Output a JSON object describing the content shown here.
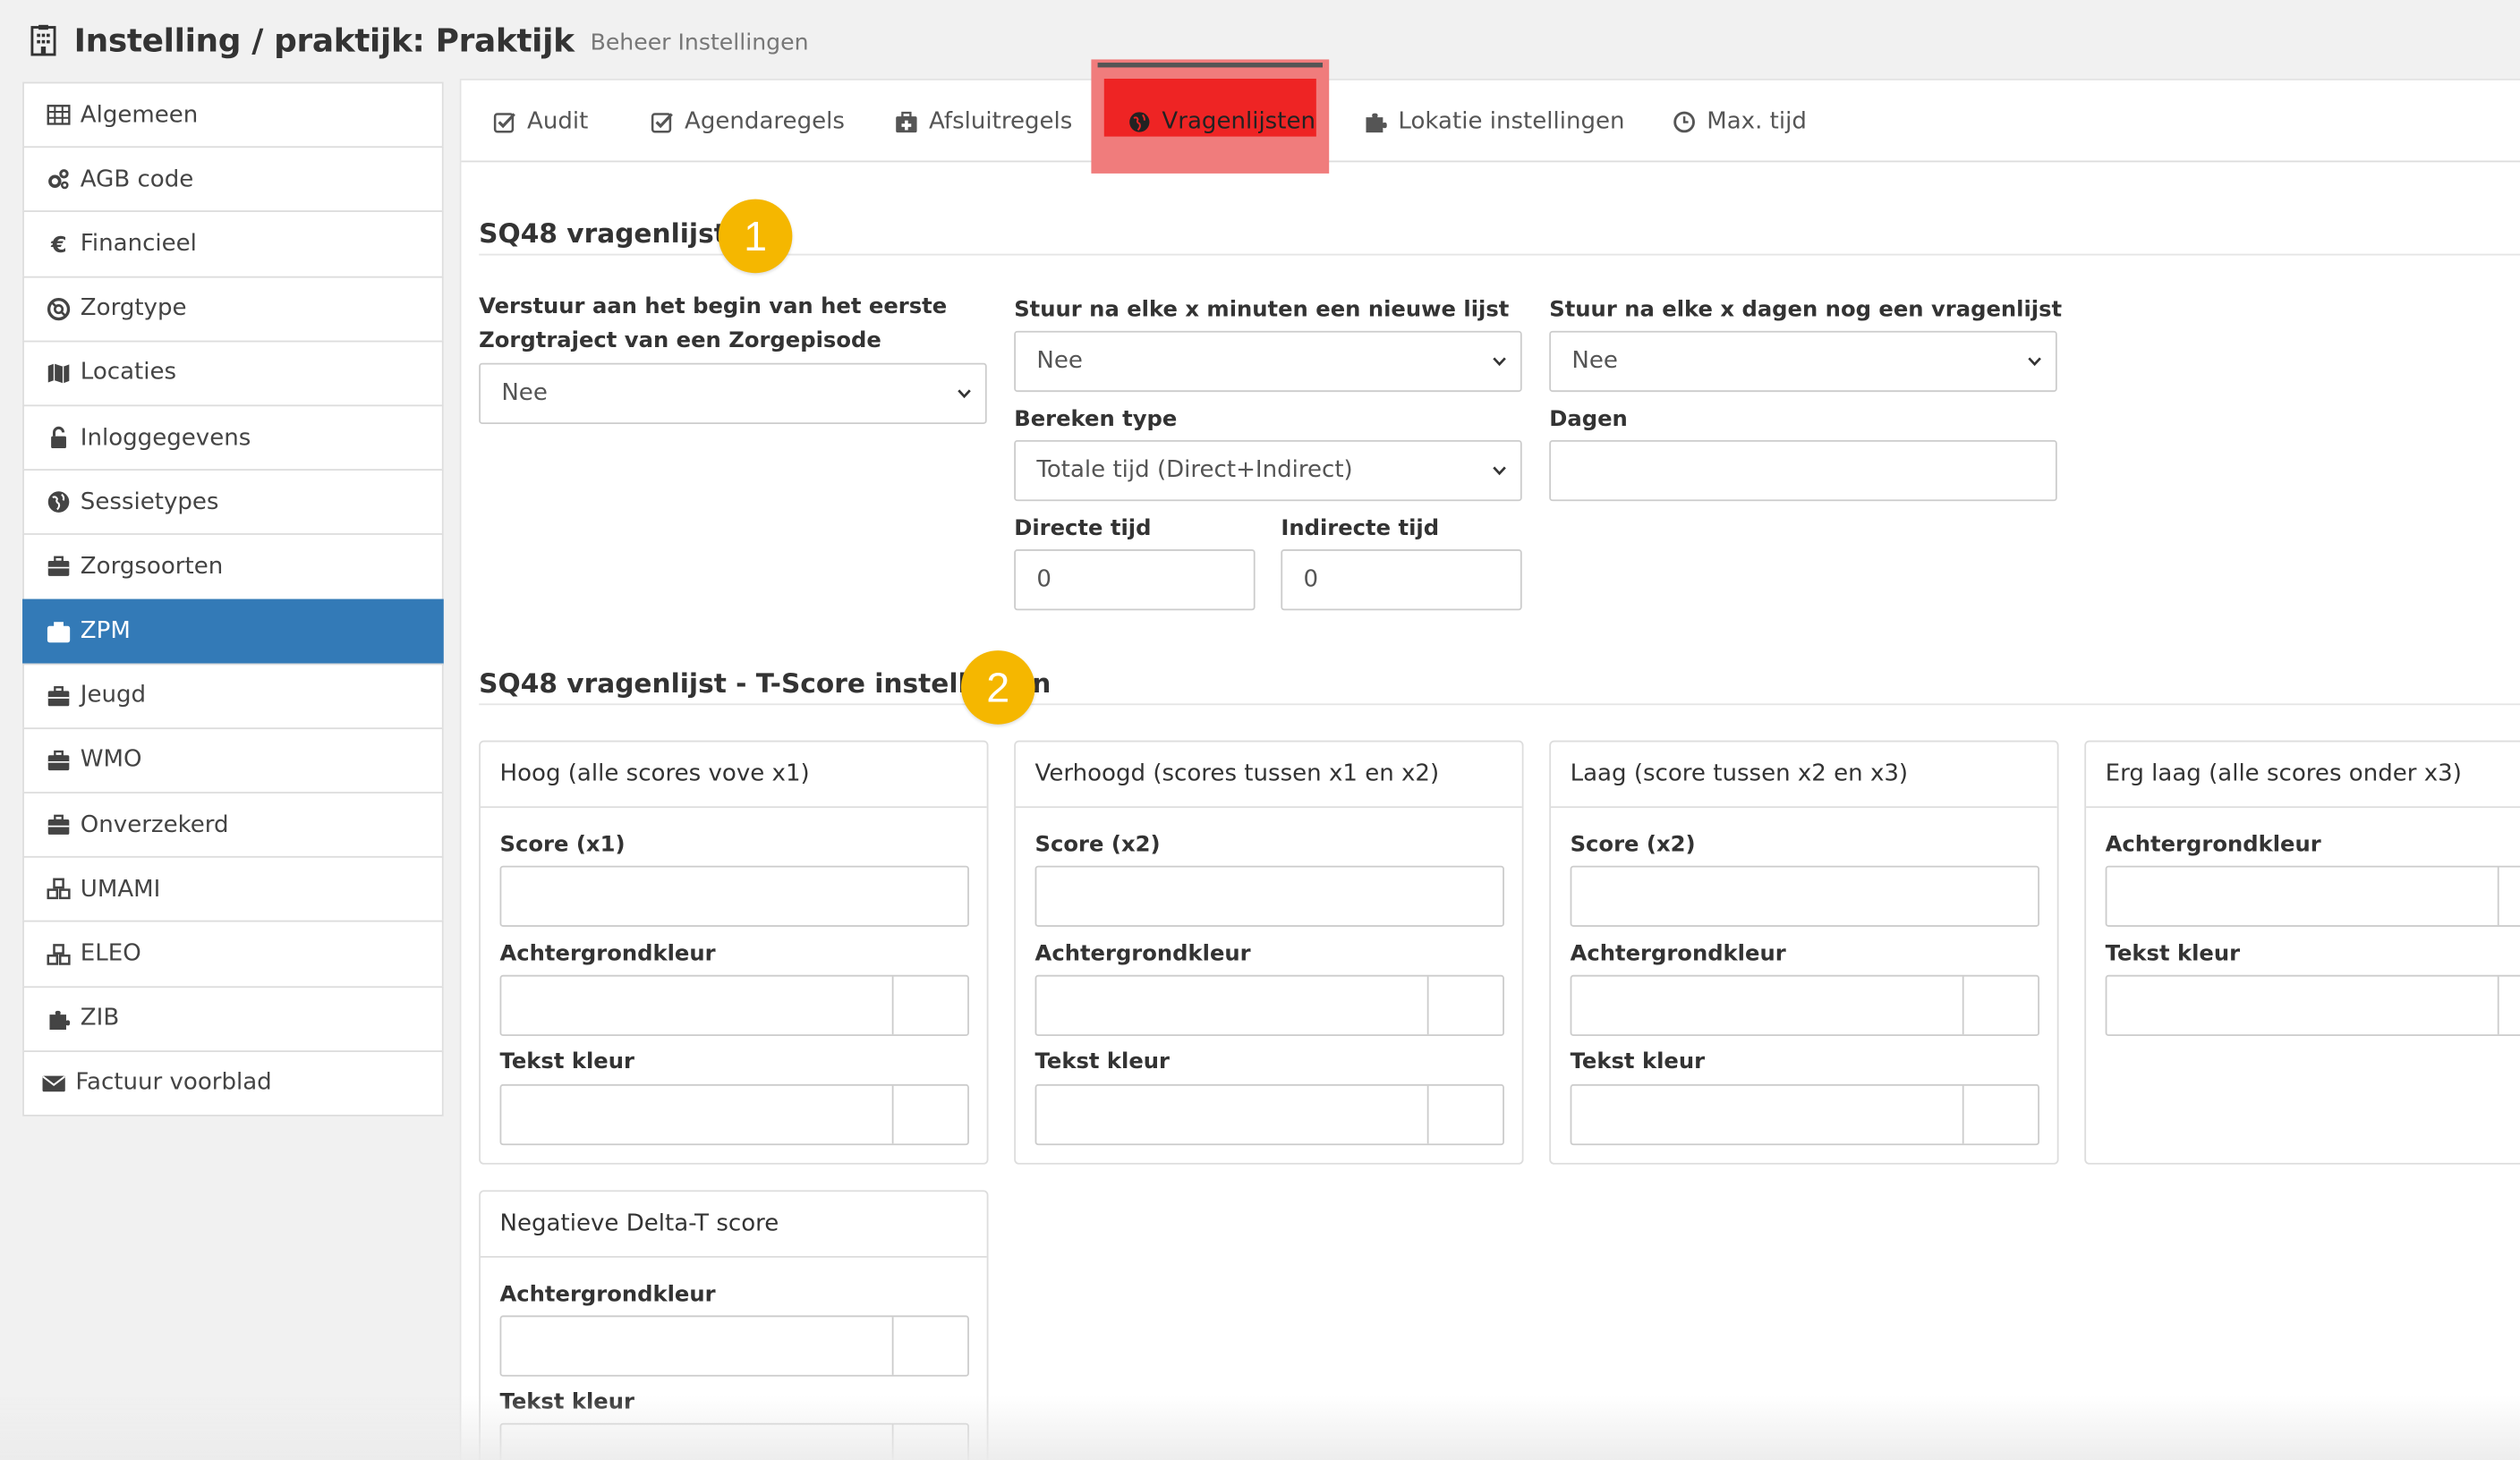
{
  "header": {
    "title": "Instelling / praktijk: Praktijk",
    "subtitle": "Beheer Instellingen"
  },
  "sidebar": {
    "items": [
      {
        "label": "Algemeen",
        "icon": "table-icon"
      },
      {
        "label": "AGB code",
        "icon": "cogs-icon"
      },
      {
        "label": "Financieel",
        "icon": "euro-icon"
      },
      {
        "label": "Zorgtype",
        "icon": "life-ring-icon"
      },
      {
        "label": "Locaties",
        "icon": "map-icon"
      },
      {
        "label": "Inloggegevens",
        "icon": "unlock-icon"
      },
      {
        "label": "Sessietypes",
        "icon": "globe-icon"
      },
      {
        "label": "Zorgsoorten",
        "icon": "briefcase-icon"
      },
      {
        "label": "ZPM",
        "icon": "briefcase-icon"
      },
      {
        "label": "Jeugd",
        "icon": "briefcase-icon"
      },
      {
        "label": "WMO",
        "icon": "briefcase-icon"
      },
      {
        "label": "Onverzekerd",
        "icon": "briefcase-icon"
      },
      {
        "label": "UMAMI",
        "icon": "cubes-icon"
      },
      {
        "label": "ELEO",
        "icon": "cubes-icon"
      },
      {
        "label": "ZIB",
        "icon": "puzzle-icon"
      },
      {
        "label": "Factuur voorblad",
        "icon": "envelope-icon"
      }
    ],
    "active_label": "ZPM",
    "active_color": "#337ab7"
  },
  "tabs": {
    "items": [
      {
        "label": "Audit",
        "icon": "check-square-icon"
      },
      {
        "label": "Agendaregels",
        "icon": "check-square-icon"
      },
      {
        "label": "Afsluitregels",
        "icon": "medkit-icon"
      },
      {
        "label": "Vragenlijsten",
        "icon": "globe-icon"
      },
      {
        "label": "Lokatie instellingen",
        "icon": "puzzle-icon"
      },
      {
        "label": "Max. tijd",
        "icon": "clock-icon"
      }
    ],
    "active_label": "Vragenlijsten",
    "highlight_color": "#ee2424"
  },
  "section1": {
    "title": "SQ48 vragenlijst",
    "badge": "1",
    "field_start_label": "Verstuur aan het begin van het eerste Zorgtraject van een Zorgepisode",
    "field_start_value": "Nee",
    "field_minutes_label": "Stuur na elke x minuten een nieuwe lijst",
    "field_minutes_value": "Nee",
    "field_days_label": "Stuur na elke x dagen nog een vragenlijst",
    "field_days_value": "Nee",
    "calc_type_label": "Bereken type",
    "calc_type_value": "Totale tijd (Direct+Indirect)",
    "dagen_label": "Dagen",
    "dagen_value": "",
    "direct_label": "Directe tijd",
    "direct_value": "0",
    "indirect_label": "Indirecte tijd",
    "indirect_value": "0"
  },
  "section2": {
    "title": "SQ48 vragenlijst - T-Score instellingen",
    "badge": "2",
    "cards": [
      {
        "title": "Hoog (alle scores vove x1)",
        "score_label": "Score (x1)",
        "bg_label": "Achtergrondkleur",
        "text_label": "Tekst kleur"
      },
      {
        "title": "Verhoogd (scores tussen x1 en x2)",
        "score_label": "Score (x2)",
        "bg_label": "Achtergrondkleur",
        "text_label": "Tekst kleur"
      },
      {
        "title": "Laag (score tussen x2 en x3)",
        "score_label": "Score (x2)",
        "bg_label": "Achtergrondkleur",
        "text_label": "Tekst kleur"
      },
      {
        "title": "Erg laag (alle scores onder x3)",
        "bg_label": "Achtergrondkleur",
        "text_label": "Tekst kleur"
      },
      {
        "title": "Negatieve Delta-T score",
        "bg_label": "Achtergrondkleur",
        "text_label": "Tekst kleur"
      }
    ]
  },
  "colors": {
    "badge": "#f5b700",
    "tab_highlight_frame": "#f07c7c"
  }
}
